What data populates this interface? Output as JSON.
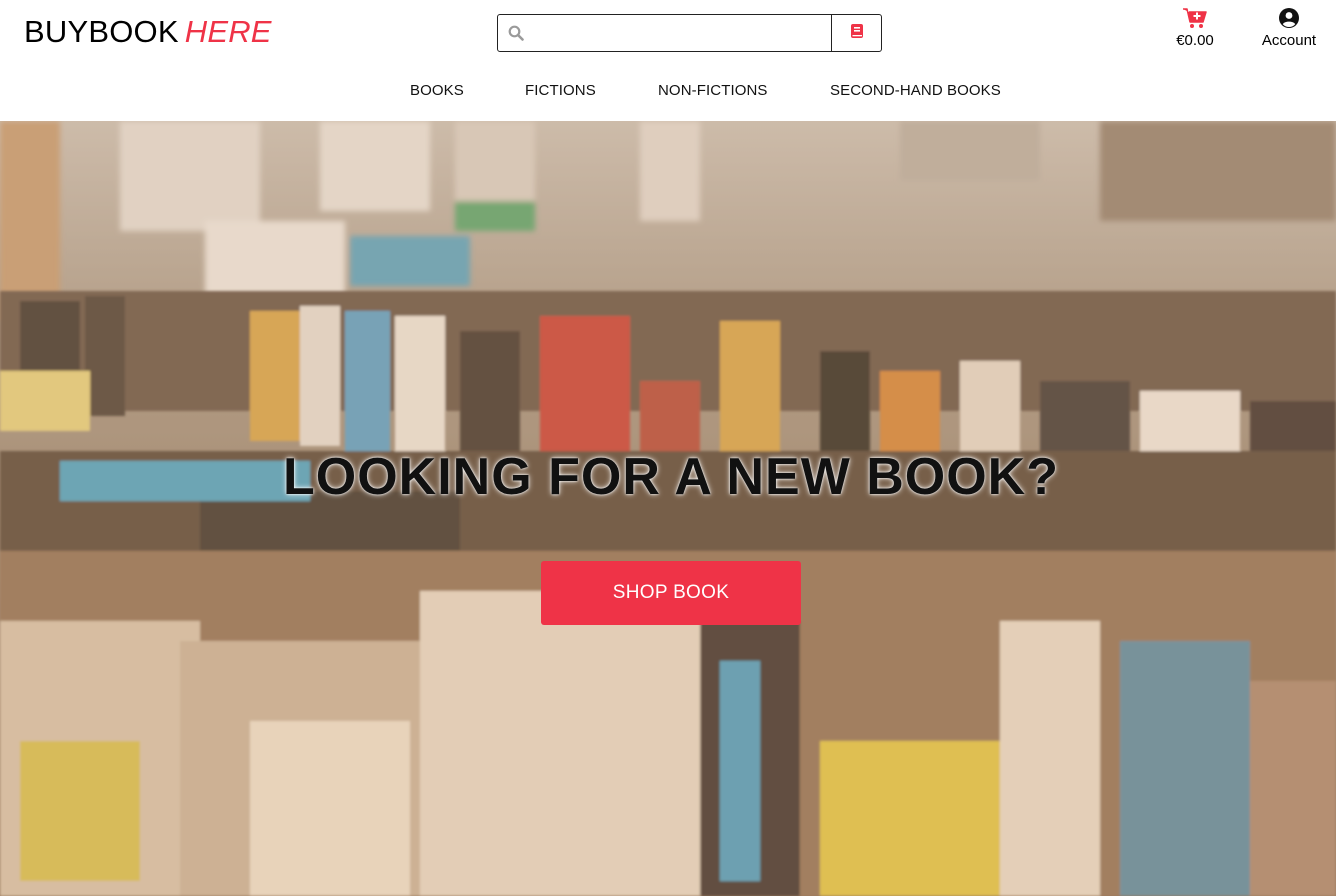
{
  "brand": {
    "name": "BUYBOOK",
    "accent": "HERE",
    "accent_color": "#ef3347"
  },
  "search": {
    "placeholder": "",
    "value": "",
    "icon": "search-icon",
    "submit_icon": "book-icon"
  },
  "cart": {
    "total": "€0.00",
    "icon": "cart-plus-icon"
  },
  "account": {
    "label": "Account",
    "icon": "user-circle-icon"
  },
  "nav": {
    "items": [
      "BOOKS",
      "FICTIONS",
      "NON-FICTIONS",
      "SECOND-HAND BOOKS"
    ]
  },
  "hero": {
    "title": "LOOKING FOR A NEW BOOK?",
    "cta_label": "SHOP BOOK",
    "cta_color": "#ef3347"
  }
}
